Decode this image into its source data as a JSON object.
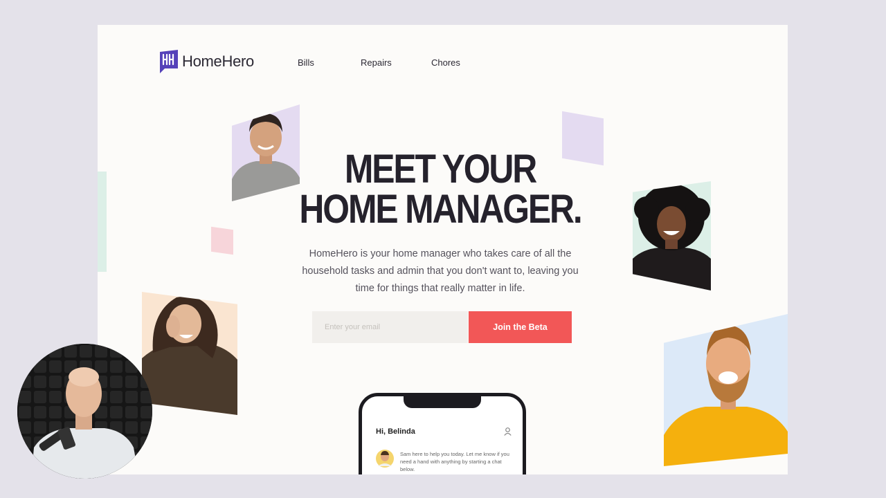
{
  "brand": {
    "name": "HomeHero",
    "logo_icon": "hh-flag-icon",
    "accent": "#5542b9"
  },
  "nav": {
    "items": [
      {
        "label": "Bills"
      },
      {
        "label": "Repairs"
      },
      {
        "label": "Chores"
      }
    ]
  },
  "hero": {
    "title_line1": "MEET YOUR",
    "title_line2": "HOME MANAGER.",
    "description": "HomeHero is your home manager who takes care of all the household tasks and admin that you don't want to, leaving you time for things that really matter in life."
  },
  "signup": {
    "email_placeholder": "Enter your email",
    "email_value": "",
    "button_label": "Join the Beta",
    "button_color": "#f25757"
  },
  "phone": {
    "greeting": "Hi, Belinda",
    "message": "Sam here to help you today. Let me know if you need a hand with anything by starting a chat below."
  },
  "colors": {
    "page_bg": "#fcfbf9",
    "outer_bg": "#e4e2ea",
    "lavender": "#e4dbf1",
    "mint": "#dcefe7",
    "pink": "#f7d5da",
    "peach": "#fae5d1",
    "sky": "#dce9f8"
  }
}
